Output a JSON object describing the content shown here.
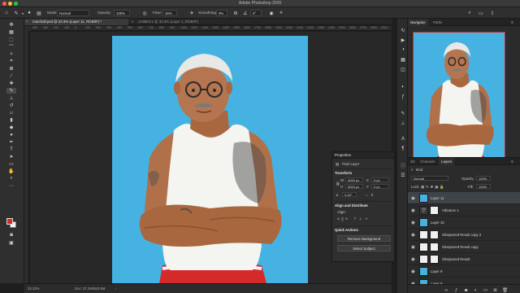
{
  "app_title": "Adobe Photoshop 2020",
  "options_bar": {
    "mode_label": "Mode:",
    "mode_value": "Normal",
    "opacity_label": "Opacity:",
    "opacity_value": "100%",
    "flow_label": "Flow:",
    "flow_value": "15%",
    "smoothing_label": "Smoothing:",
    "smoothing_value": "0%",
    "angle_value": "0°"
  },
  "document_tabs": [
    {
      "label": "marshall.psd @ 33.3% (Layer 11, RGB/8*) *"
    },
    {
      "label": "Untitled-1 @ 33.3% (Layer 1, RGB/8*)"
    }
  ],
  "ruler_ticks": [
    "400",
    "300",
    "200",
    "100",
    "0",
    "100",
    "200",
    "300",
    "400",
    "500",
    "600",
    "700",
    "800",
    "900",
    "1000",
    "1100",
    "1200",
    "1300",
    "1400",
    "1500",
    "1600",
    "1700",
    "1800",
    "1900",
    "2000",
    "2100",
    "2200",
    "2300",
    "2400",
    "2500",
    "2600",
    "2700",
    "2800",
    "2900"
  ],
  "status_bar": {
    "zoom": "33.33%",
    "doc": "Doc: 37.2M/663.8M"
  },
  "navigator": {
    "tabs": [
      "Navigator",
      "Paths"
    ],
    "zoom": "33.33%"
  },
  "properties": {
    "title": "Properties",
    "layer_type": "Pixel Layer",
    "transform_heading": "Transform",
    "w_label": "W",
    "w_value": "4000 px",
    "h_label": "H",
    "h_value": "5000 px",
    "x_label": "X",
    "x_value": "0 px",
    "y_label": "Y",
    "y_value": "0 px",
    "angle_value": "0.00°",
    "align_heading": "Align and Distribute",
    "align_label": "Align:",
    "quick_actions_heading": "Quick Actions",
    "remove_bg_label": "Remove Background",
    "select_subject_label": "Select Subject"
  },
  "layers": {
    "tabs": [
      "3D",
      "Channels",
      "Layers"
    ],
    "kind_label": "Kind",
    "blend_mode": "Normal",
    "opacity_label": "Opacity:",
    "opacity_value": "100%",
    "lock_label": "Lock:",
    "fill_label": "Fill:",
    "fill_value": "100%",
    "items": [
      {
        "name": "Layer 11",
        "thumb": "portrait"
      },
      {
        "name": "Vibrance 1",
        "thumb": "adjustment"
      },
      {
        "name": "Layer 10",
        "thumb": "portrait"
      },
      {
        "name": "Sharpened Result copy 2",
        "thumb": "white"
      },
      {
        "name": "Sharpened Result copy",
        "thumb": "white"
      },
      {
        "name": "Sharpened Result",
        "thumb": "white"
      },
      {
        "name": "Layer 9",
        "thumb": "portrait"
      },
      {
        "name": "Layer 8",
        "thumb": "portrait"
      }
    ]
  },
  "colors": {
    "canvas_bg": "#46b2e2",
    "foreground": "#d62b2b",
    "background": "#f2f2f2",
    "selected_layer": "#3f4448"
  }
}
